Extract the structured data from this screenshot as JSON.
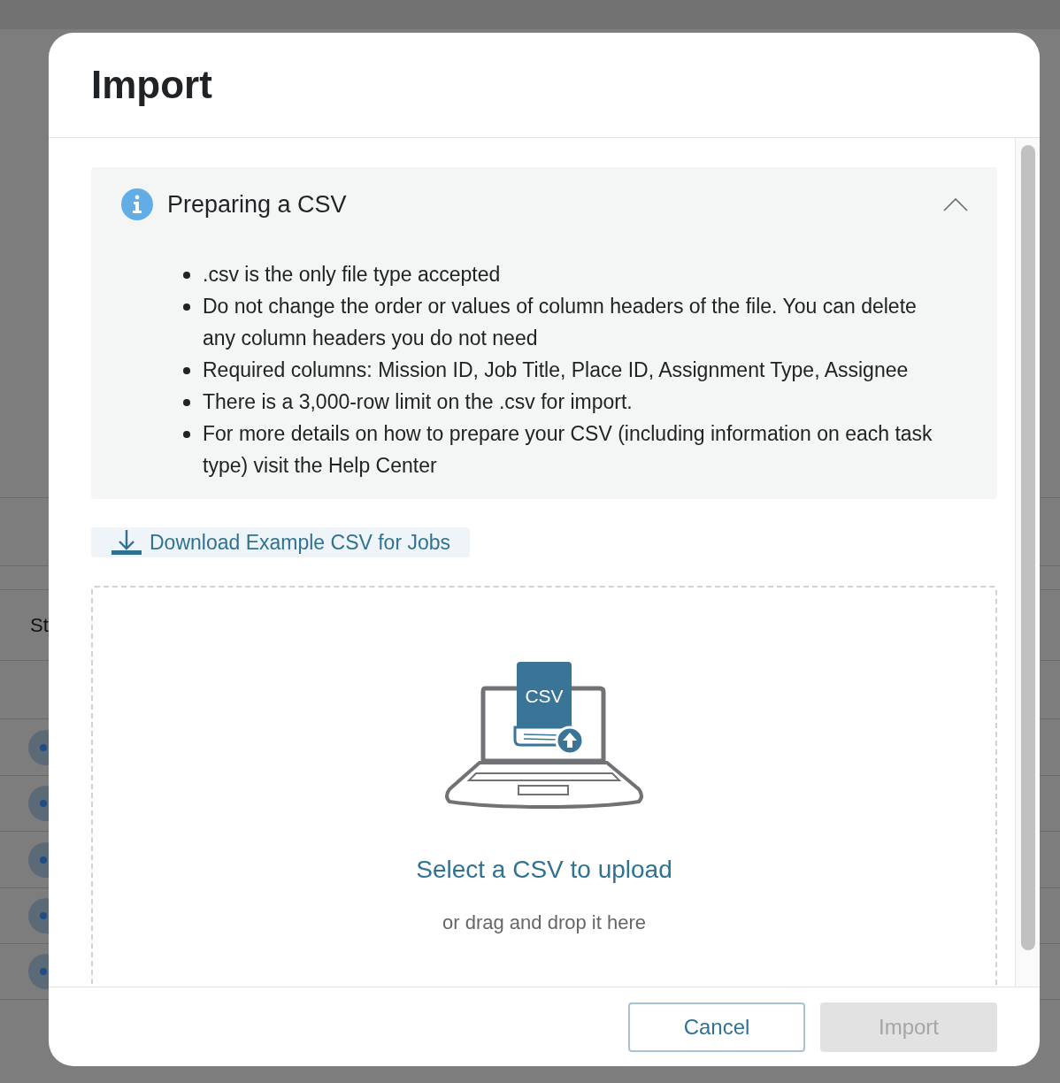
{
  "background": {
    "column_header": "St"
  },
  "dialog": {
    "title": "Import",
    "info": {
      "title": "Preparing a CSV",
      "expanded": true,
      "bullets": [
        ".csv is the only file type accepted",
        "Do not change the order or values of column headers of the file. You can delete any column headers you do not need",
        "Required columns: Mission ID, Job Title, Place ID, Assignment Type, Assignee",
        "There is a 3,000-row limit on the .csv for import.",
        "For more details on how to prepare your CSV (including information on each task type) visit the Help Center"
      ]
    },
    "download_button": "Download Example CSV for Jobs",
    "dropzone": {
      "icon_label": "CSV",
      "title": "Select a CSV to upload",
      "subtitle": "or drag and drop it here"
    },
    "buttons": [
      {
        "label": "Cancel",
        "kind": "secondary",
        "disabled": false
      },
      {
        "label": "Import",
        "kind": "primary",
        "disabled": true
      }
    ]
  }
}
